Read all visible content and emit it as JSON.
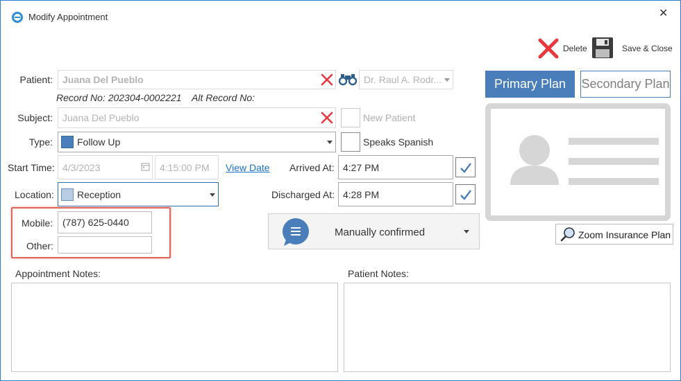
{
  "window": {
    "title": "Modify Appointment",
    "close_glyph": "✕"
  },
  "toolbar": {
    "delete_label": "Delete",
    "save_close_label": "Save & Close"
  },
  "patient": {
    "label": "Patient:",
    "value": "Juana Del Pueblo",
    "record_no": "Record No: 202304-0002221",
    "alt_record_no": "Alt Record No:"
  },
  "provider": {
    "value": "Dr. Raul A. Rodr..."
  },
  "subject": {
    "label": "Subject:",
    "value": "Juana Del Pueblo"
  },
  "new_patient": {
    "label": "New Patient",
    "checked": false
  },
  "speaks_spanish": {
    "label": "Speaks Spanish",
    "checked": false
  },
  "type": {
    "label": "Type:",
    "value": "Follow Up",
    "color": "#4a7ebb"
  },
  "start_time": {
    "label": "Start Time:",
    "date": "4/3/2023",
    "time": "4:15:00 PM",
    "view_date_link": "View Date"
  },
  "arrived": {
    "label": "Arrived At:",
    "value": "4:27 PM"
  },
  "location": {
    "label": "Location:",
    "value": "Reception",
    "color": "#b8cce4"
  },
  "discharged": {
    "label": "Discharged At:",
    "value": "4:28 PM"
  },
  "contact": {
    "mobile_label": "Mobile:",
    "mobile_value": "(787) 625-0440",
    "other_label": "Other:",
    "other_value": ""
  },
  "confirmation": {
    "value": "Manually confirmed",
    "icon_color": "#4a7ebb"
  },
  "plans": {
    "primary_label": "Primary Plan",
    "secondary_label": "Secondary Plan",
    "active": "primary"
  },
  "zoom_insurance_label": "Zoom Insurance Plan",
  "notes": {
    "appointment_label": "Appointment Notes:",
    "patient_label": "Patient Notes:"
  },
  "colors": {
    "accent": "#4a7ebb",
    "delete_red": "#e8383d",
    "highlight_box": "#e0665a",
    "link": "#1a73c9"
  }
}
